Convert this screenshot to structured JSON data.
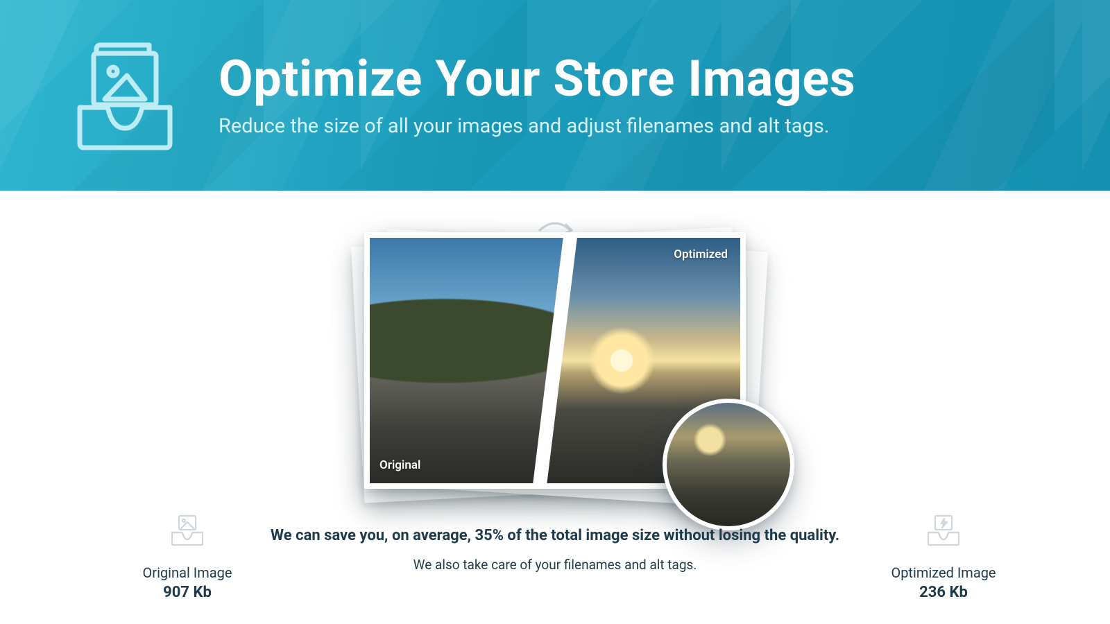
{
  "hero": {
    "title": "Optimize Your Store Images",
    "subtitle": "Reduce the size of all your images and adjust filenames and alt tags."
  },
  "stats": {
    "original": {
      "label": "Original Image",
      "value": "907 Kb"
    },
    "optimized": {
      "label": "Optimized Image",
      "value": "236 Kb"
    }
  },
  "compare": {
    "original_tag": "Original",
    "optimized_tag": "Optimized"
  },
  "blurb": {
    "line1": "We can save you, on average, 35% of the total image size without losing the quality.",
    "line2": "We also take care of your filenames and alt tags."
  }
}
